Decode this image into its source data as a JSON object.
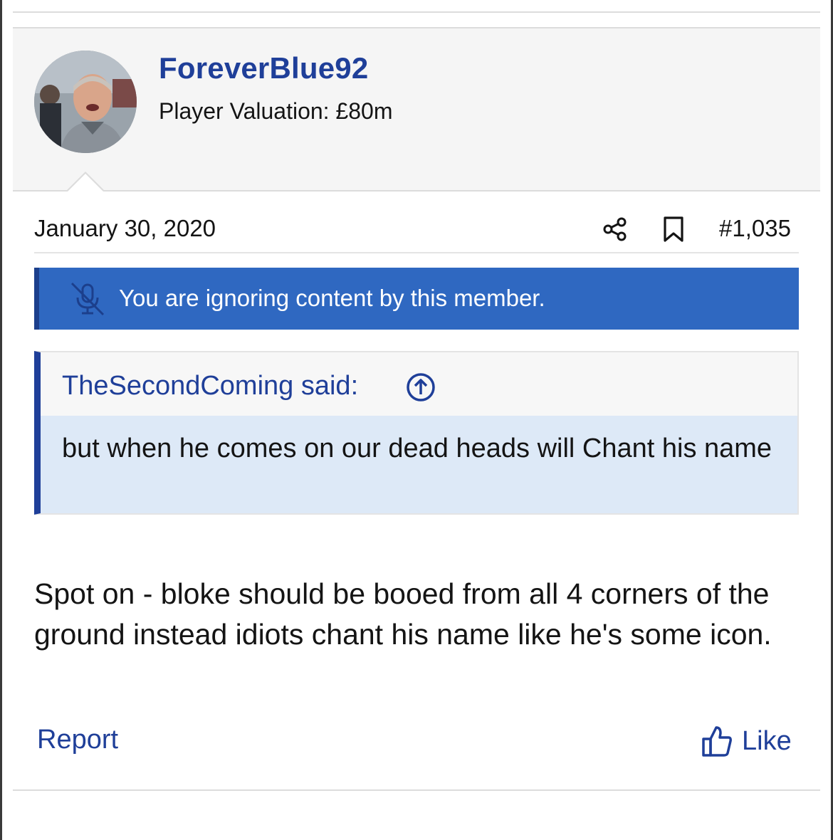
{
  "post": {
    "author": {
      "username": "ForeverBlue92",
      "valuation": "Player Valuation: £80m"
    },
    "date": "January 30, 2020",
    "number": "#1,035",
    "ignore_notice": "You are ignoring content by this member.",
    "quote": {
      "author_line": "TheSecondComing said:",
      "text": "but when he comes on our dead heads will Chant his name"
    },
    "body": "Spot on - bloke should be booed from all 4 corners of the ground instead idiots chant his name like he's some icon.",
    "actions": {
      "report_label": "Report",
      "like_label": "Like"
    }
  },
  "icons": {
    "share": "share-icon",
    "bookmark": "bookmark-icon",
    "ignore": "muted-microphone-icon",
    "quote_jump": "arrow-up-circle-icon",
    "like": "thumbs-up-icon"
  },
  "colors": {
    "brand_blue": "#1f3f99",
    "banner_blue": "#2f68c1",
    "quote_bg": "#dde9f7",
    "header_bg": "#f5f5f5"
  }
}
